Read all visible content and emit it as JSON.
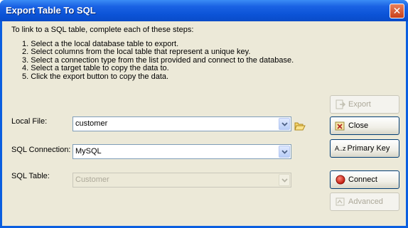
{
  "window": {
    "title": "Export Table To SQL"
  },
  "intro": "To link to a SQL table, complete each of these steps:",
  "steps": [
    "1. Select a the local database table to export.",
    "2. Select columns from the local table that represent a unique key.",
    "3. Select a connection type from the list provided and connect to the database.",
    "4. Select a target table to copy the data to.",
    "5. Click the export button to copy the data."
  ],
  "fields": {
    "local_file": {
      "label": "Local File:",
      "value": "customer"
    },
    "sql_connection": {
      "label": "SQL Connection:",
      "value": "MySQL"
    },
    "sql_table": {
      "label": "SQL Table:",
      "value": "Customer"
    }
  },
  "buttons": {
    "export": "Export",
    "close": "Close",
    "primary_key_prefix": "A..z",
    "primary_key": "Primary Key",
    "connect": "Connect",
    "advanced": "Advanced"
  },
  "icons": {
    "close_window": "close-icon",
    "dropdown": "chevron-down-icon",
    "browse": "folder-icon",
    "export": "export-icon",
    "close": "close-file-icon",
    "connect": "red-circle-icon",
    "advanced": "settings-icon"
  },
  "colors": {
    "title_bar": "#0b53d6",
    "client_bg": "#ece9d8",
    "close_button": "#c9401a",
    "connect_icon": "#d9261c"
  }
}
